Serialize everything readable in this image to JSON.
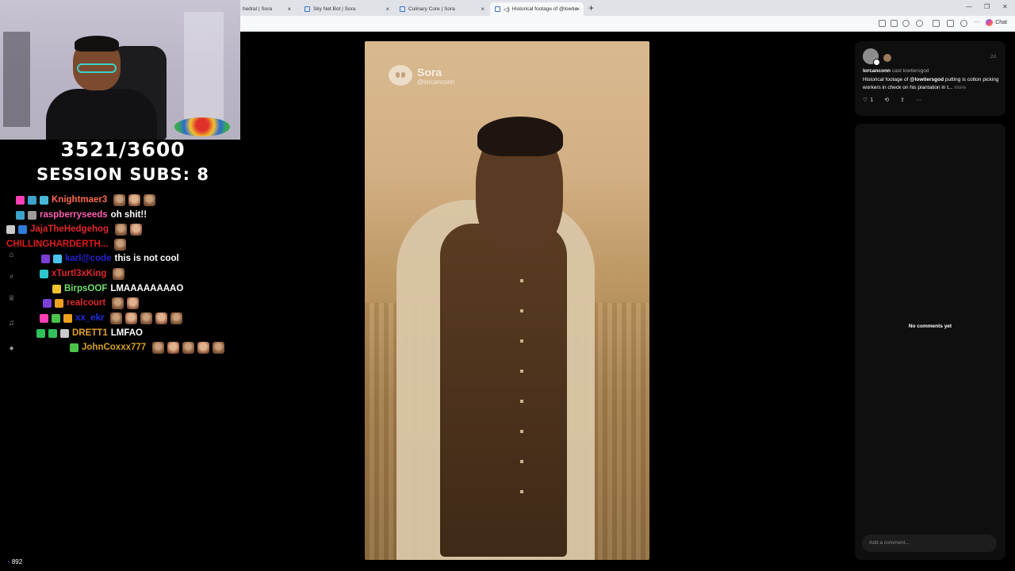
{
  "browser": {
    "tabs": [
      {
        "title": "hedral | Sora",
        "active": false
      },
      {
        "title": "Sky Net Bot | Sora",
        "active": false
      },
      {
        "title": "Culinary Core | Sora",
        "active": false
      },
      {
        "title": "Historical footage of @lowtie",
        "active": true
      }
    ],
    "chat_label": "Chat"
  },
  "overlay": {
    "sub_counter": "3521/3600",
    "session_subs": "SESSION SUBS: 8",
    "viewer_count": "892"
  },
  "chat": [
    {
      "user": "Knightmaer3",
      "color": "#ff6a4d",
      "message": "",
      "emotes": 3,
      "badges": [
        "#ff3fb4",
        "#3da3c9",
        "#49b8d8"
      ]
    },
    {
      "user": "raspberryseeds",
      "color": "#ff5fb0",
      "message": "oh shit!!",
      "emotes": 0,
      "badges": [
        "#3da3c9",
        "#9b9b9b"
      ]
    },
    {
      "user": "JajaTheHedgehog",
      "color": "#e02828",
      "message": "",
      "emotes": 2,
      "badges": [
        "#c9c9c9",
        "#2f7dd8"
      ]
    },
    {
      "user": "CHILLINGHARDERTH...",
      "color": "#e01919",
      "message": "",
      "emotes": 1,
      "badges": []
    },
    {
      "user": "karl@code",
      "color": "#2424d0",
      "message": "this is not cool",
      "emotes": 0,
      "badges": [
        "#7c3fd6",
        "#4cc3f0"
      ]
    },
    {
      "user": "xTurtl3xKing",
      "color": "#e0282a",
      "message": "",
      "emotes": 1,
      "badges": [
        "#2ec7cf"
      ]
    },
    {
      "user": "BirpsOOF",
      "color": "#6fe06a",
      "message": "LMAAAAAAAAO",
      "emotes": 0,
      "badges": [
        "#f0c430"
      ]
    },
    {
      "user": "realcourt",
      "color": "#e02a2a",
      "message": "",
      "emotes": 2,
      "badges": [
        "#7c3fd6",
        "#f0a020"
      ]
    },
    {
      "user": "xx_ekr",
      "color": "#1f2ee0",
      "message": "",
      "emotes": 5,
      "badges": [
        "#ff3fb4",
        "#4cc34a",
        "#f0a020"
      ]
    },
    {
      "user": "DRETT1",
      "color": "#e0a02a",
      "message": "LMFAO",
      "emotes": 0,
      "badges": [
        "#30c05a",
        "#30c05a",
        "#c9c9c9"
      ]
    },
    {
      "user": "JohnCoxxx777",
      "color": "#d4a020",
      "message": "",
      "emotes": 5,
      "badges": [
        "#4cc34a"
      ]
    }
  ],
  "video": {
    "watermark_brand": "Sora",
    "watermark_handle": "@lorcanconn"
  },
  "post": {
    "author": "lorcanconn",
    "cast_text": "cast lowtiersgod",
    "time": "2d",
    "text_prefix": "Historical footage of ",
    "mention": "@lowtiersgod",
    "text_rest": " putting is cotton picking workers in check on his plantation in t...",
    "more_label": "more",
    "like_count": "1"
  },
  "comments": {
    "empty_label": "No comments yet",
    "input_placeholder": "Add a comment..."
  }
}
